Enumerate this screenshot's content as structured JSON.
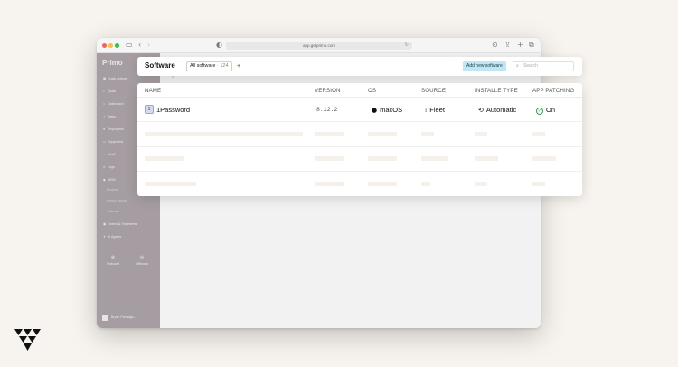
{
  "browser": {
    "url": "app.getprimo.com"
  },
  "sidebar": {
    "logo": "Primo",
    "items": [
      {
        "label": "Quick actions",
        "icon": "grid-icon"
      },
      {
        "label": "Quick",
        "icon": "search-icon"
      },
      {
        "label": "Dashboard",
        "icon": "home-icon"
      },
      {
        "label": "Tasks",
        "icon": "check-icon"
      },
      {
        "label": "Employees",
        "icon": "user-icon"
      },
      {
        "label": "Equipment",
        "icon": "laptop-icon"
      },
      {
        "label": "SaaS",
        "icon": "cloud-icon"
      },
      {
        "label": "Logs",
        "icon": "list-icon"
      },
      {
        "label": "MDM",
        "icon": "shield-icon"
      }
    ],
    "subitems": [
      "Devices",
      "Device groups",
      "Software"
    ],
    "items_bottom": [
      {
        "label": "Orders & Shipments",
        "icon": "box-icon"
      },
      {
        "label": "AI Agents",
        "icon": "sparkle-icon"
      }
    ],
    "bottom_buttons": [
      {
        "label": "Onboard",
        "icon": "plus-icon"
      },
      {
        "label": "Offboard",
        "icon": "minus-icon"
      }
    ],
    "user": "Bryan Pantalgo..."
  },
  "header": {
    "title": "Software",
    "filter_label": "All software",
    "filter_count": "· 124",
    "add_button": "Add new software",
    "search_placeholder": "Search"
  },
  "table": {
    "columns": [
      "NAME",
      "VERSION",
      "OS",
      "SOURCE",
      "INSTALLE TYPE",
      "APP PATCHING"
    ],
    "rows": [
      {
        "icon_letter": "1",
        "name": "1Password",
        "version": "8.12.2",
        "os": "macOS",
        "source": "Fleet",
        "install_type": "Automatic",
        "patching": "On"
      }
    ]
  },
  "colors": {
    "sidebar": "#a59da1",
    "accent_button": "#bfe6f2",
    "patching_on": "#2e9e55",
    "page_bg": "#f7f3ee"
  }
}
